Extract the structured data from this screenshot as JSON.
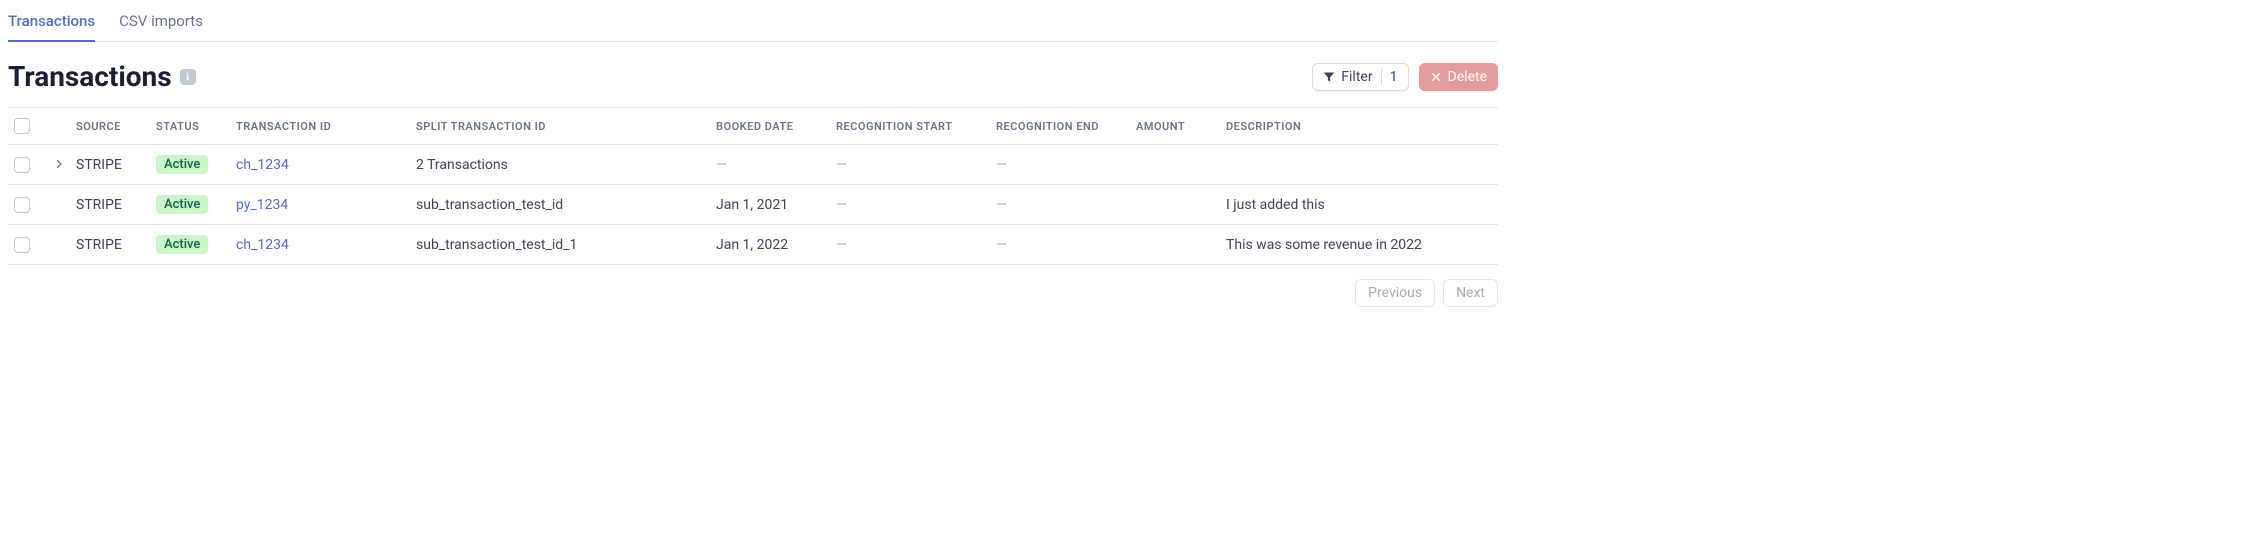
{
  "tabs": [
    {
      "label": "Transactions",
      "active": true
    },
    {
      "label": "CSV imports",
      "active": false
    }
  ],
  "header": {
    "title": "Transactions",
    "info_glyph": "i",
    "filter_label": "Filter",
    "filter_count": "1",
    "delete_label": "Delete"
  },
  "columns": {
    "source": "SOURCE",
    "status": "STATUS",
    "txid": "TRANSACTION ID",
    "split": "SPLIT TRANSACTION ID",
    "booked": "BOOKED DATE",
    "rec_start": "RECOGNITION START",
    "rec_end": "RECOGNITION END",
    "amount": "AMOUNT",
    "desc": "DESCRIPTION"
  },
  "rows": [
    {
      "expandable": true,
      "source": "STRIPE",
      "status": "Active",
      "txid": "ch_1234",
      "split": "2 Transactions",
      "booked": "—",
      "rec_start": "—",
      "rec_end": "—",
      "amount": "",
      "desc": ""
    },
    {
      "expandable": false,
      "source": "STRIPE",
      "status": "Active",
      "txid": "py_1234",
      "split": "sub_transaction_test_id",
      "booked": "Jan 1, 2021",
      "rec_start": "—",
      "rec_end": "—",
      "amount": "",
      "desc": "I just added this"
    },
    {
      "expandable": false,
      "source": "STRIPE",
      "status": "Active",
      "txid": "ch_1234",
      "split": "sub_transaction_test_id_1",
      "booked": "Jan 1, 2022",
      "rec_start": "—",
      "rec_end": "—",
      "amount": "",
      "desc": "This was some revenue in 2022"
    }
  ],
  "pagination": {
    "prev": "Previous",
    "next": "Next"
  }
}
